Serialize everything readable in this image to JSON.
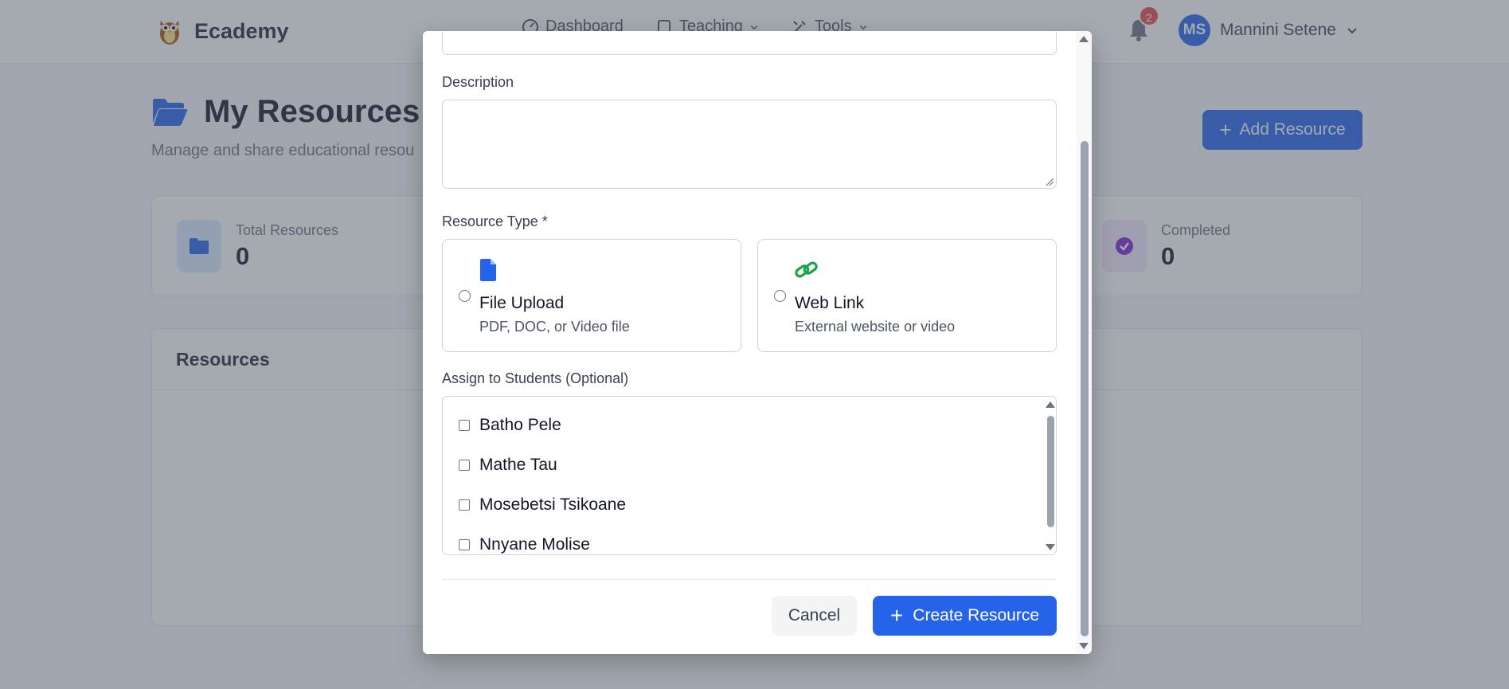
{
  "app": {
    "name": "Ecademy"
  },
  "nav": {
    "links": [
      {
        "label": "Dashboard"
      },
      {
        "label": "Teaching"
      },
      {
        "label": "Tools"
      }
    ],
    "notifications_count": "2",
    "user": {
      "initials": "MS",
      "name": "Mannini Setene"
    }
  },
  "page": {
    "title": "My Resources",
    "subtitle": "Manage and share educational resou",
    "add_button": "Add Resource"
  },
  "stats": [
    {
      "label": "Total Resources",
      "value": "0",
      "icon": "folder-icon",
      "color": "#2563eb"
    },
    {
      "label": "Completed",
      "value": "0",
      "icon": "check-circle-icon",
      "color": "#7e22ce"
    }
  ],
  "resources_panel": {
    "title": "Resources"
  },
  "modal": {
    "description_label": "Description",
    "description_value": "",
    "resource_type_label": "Resource Type *",
    "types": [
      {
        "title": "File Upload",
        "desc": "PDF, DOC, or Video file",
        "icon": "file-icon",
        "color": "#2563eb"
      },
      {
        "title": "Web Link",
        "desc": "External website or video",
        "icon": "link-icon",
        "color": "#16a34a"
      }
    ],
    "students_label": "Assign to Students (Optional)",
    "students": [
      {
        "name": "Batho Pele"
      },
      {
        "name": "Mathe Tau"
      },
      {
        "name": "Mosebetsi Tsikoane"
      },
      {
        "name": "Nnyane Molise"
      }
    ],
    "cancel_label": "Cancel",
    "create_label": "Create Resource"
  },
  "colors": {
    "primary": "#2563eb",
    "overlay": "rgba(75,85,99,0.5)"
  }
}
